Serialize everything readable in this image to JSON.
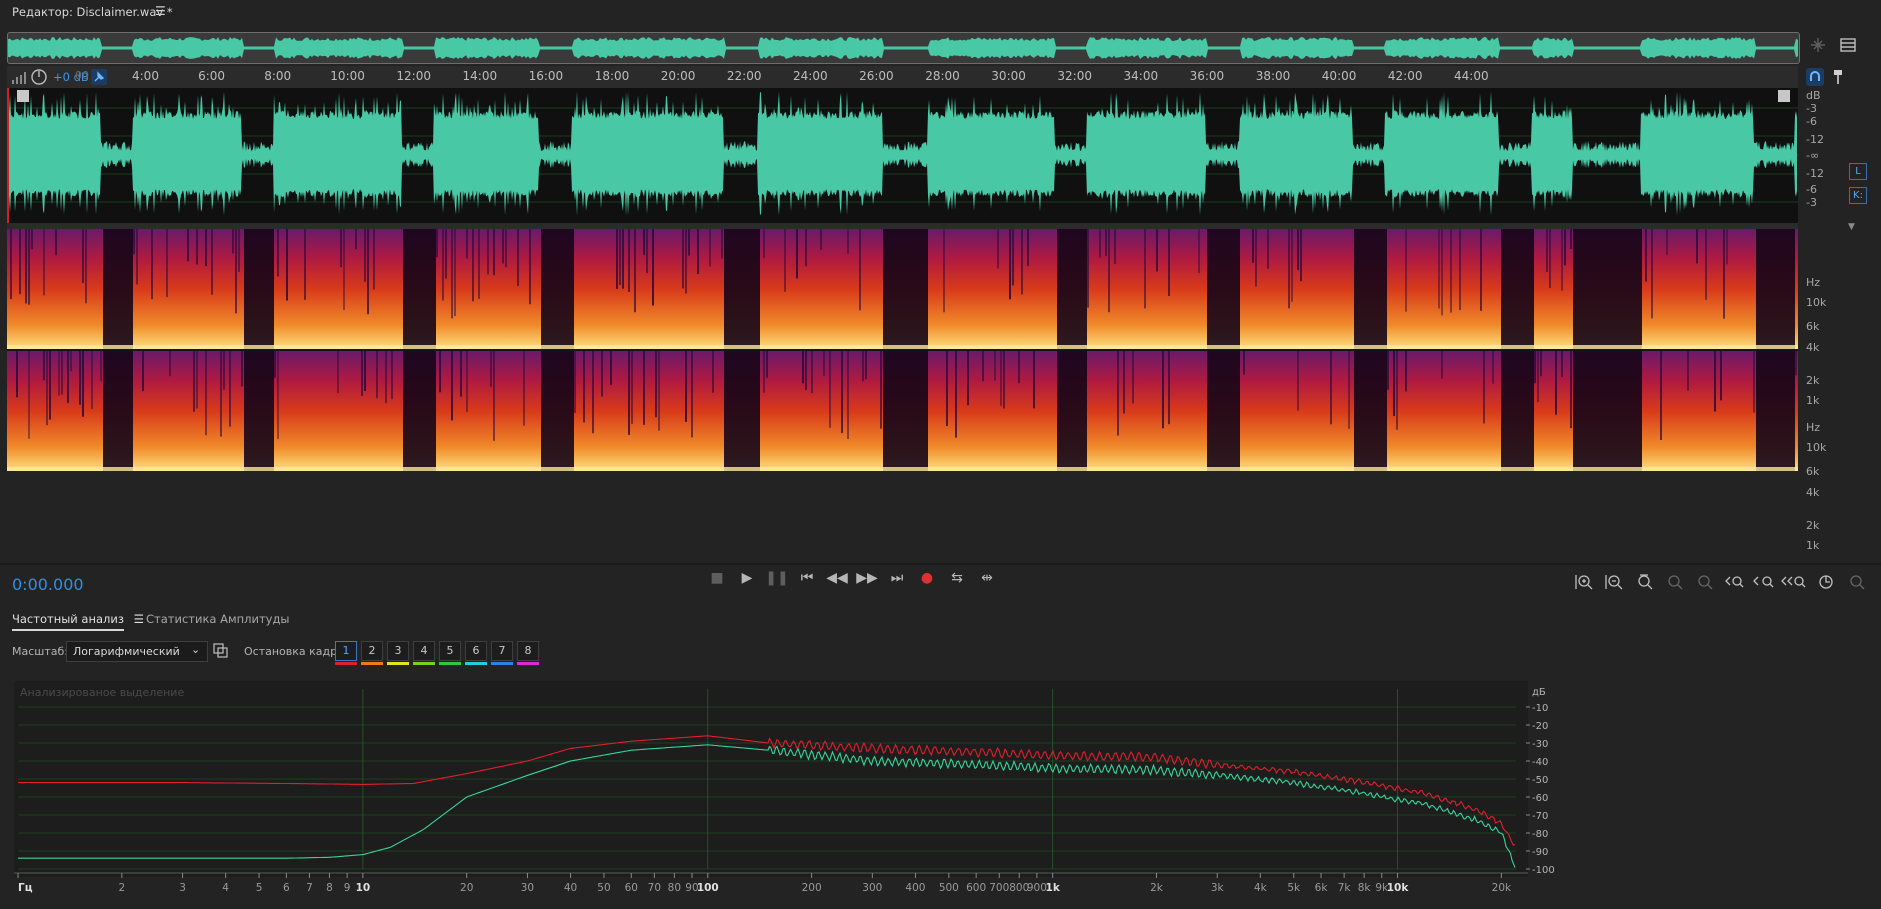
{
  "titlebar": {
    "title": "Редактор: Disclaimer.wav *",
    "menu_icon": "☰"
  },
  "colors": {
    "wave": "#48c8a5",
    "accent": "#2f8fe6",
    "series1": "#e01f2c",
    "series2": "#38d49a"
  },
  "ruler": {
    "gain_label": "+0 dB",
    "start_label": "00",
    "ticks": [
      "4:00",
      "6:00",
      "8:00",
      "10:00",
      "12:00",
      "14:00",
      "16:00",
      "18:00",
      "20:00",
      "22:00",
      "24:00",
      "26:00",
      "28:00",
      "30:00",
      "32:00",
      "34:00",
      "36:00",
      "38:00",
      "40:00",
      "42:00",
      "44:00"
    ]
  },
  "wave_scale": {
    "unit": "dB",
    "labels": [
      "-3",
      "-6",
      "-12",
      "-∞",
      "-12",
      "-6",
      "-3"
    ],
    "channel_l": "L",
    "channel_r": "K:"
  },
  "spectrogram": {
    "unit": "Hz",
    "labels": [
      "10k",
      "6k",
      "4k",
      "2k",
      "1k"
    ]
  },
  "transport": {
    "time": "0:00.000"
  },
  "panel": {
    "tabs": [
      {
        "label": "Частотный анализ",
        "active": true
      },
      {
        "label": "Статистика Амплитуды",
        "active": false
      }
    ],
    "tab_menu_icon": "☰",
    "scale_label": "Масштаб:",
    "scale_value": "Логарифмический",
    "freeze_label": "Остановка кадра:",
    "freeze_buttons": [
      "1",
      "2",
      "3",
      "4",
      "5",
      "6",
      "7",
      "8"
    ],
    "freeze_colors": [
      "#e01f2c",
      "#f07a14",
      "#e8e020",
      "#7ad020",
      "#2cc84a",
      "#20d0d8",
      "#2a84e8",
      "#d82ad8"
    ]
  },
  "chart_data": {
    "type": "line",
    "annotation": "Анализированое выделение",
    "x_scale": "log",
    "xlim": [
      1,
      22050
    ],
    "ylim": [
      -100,
      0
    ],
    "x_tick_labels": [
      "Гц",
      "2",
      "3",
      "4",
      "5",
      "6",
      "7",
      "8",
      "9",
      "10",
      "20",
      "30",
      "40",
      "50",
      "60",
      "70",
      "80",
      "90",
      "100",
      "200",
      "300",
      "400",
      "500",
      "600",
      "700",
      "800",
      "900",
      "1k",
      "2k",
      "3k",
      "4k",
      "5k",
      "6k",
      "7k",
      "8k",
      "9k",
      "10k",
      "20k"
    ],
    "x_tick_values": [
      1,
      2,
      3,
      4,
      5,
      6,
      7,
      8,
      9,
      10,
      20,
      30,
      40,
      50,
      60,
      70,
      80,
      90,
      100,
      200,
      300,
      400,
      500,
      600,
      700,
      800,
      900,
      1000,
      2000,
      3000,
      4000,
      5000,
      6000,
      7000,
      8000,
      9000,
      10000,
      20000
    ],
    "y_unit": "дБ",
    "y_ticks": [
      -10,
      -20,
      -30,
      -40,
      -50,
      -60,
      -70,
      -80,
      -90,
      -100
    ],
    "grid": true,
    "series": [
      {
        "color": "#e01f2c",
        "x": [
          1,
          3,
          6,
          10,
          14,
          20,
          30,
          40,
          60,
          100,
          150,
          300,
          600,
          1000,
          2000,
          3000,
          5000,
          8000,
          12000,
          17000,
          20000,
          22050
        ],
        "y": [
          -52,
          -52,
          -52.5,
          -53,
          -52.5,
          -47,
          -40,
          -33,
          -29,
          -26,
          -30,
          -33,
          -35,
          -37,
          -38,
          -42,
          -46,
          -52,
          -58,
          -67,
          -75,
          -88
        ]
      },
      {
        "color": "#38d49a",
        "x": [
          1,
          3,
          6,
          8,
          10,
          12,
          15,
          20,
          30,
          40,
          60,
          100,
          150,
          300,
          600,
          1000,
          2000,
          3000,
          5000,
          8000,
          12000,
          17000,
          20000,
          22050
        ],
        "y": [
          -94,
          -94,
          -94,
          -93.5,
          -92,
          -88,
          -78,
          -60,
          -48,
          -40,
          -34,
          -31,
          -34,
          -40,
          -42,
          -44,
          -45,
          -48,
          -52,
          -58,
          -64,
          -73,
          -80,
          -100
        ]
      }
    ]
  }
}
